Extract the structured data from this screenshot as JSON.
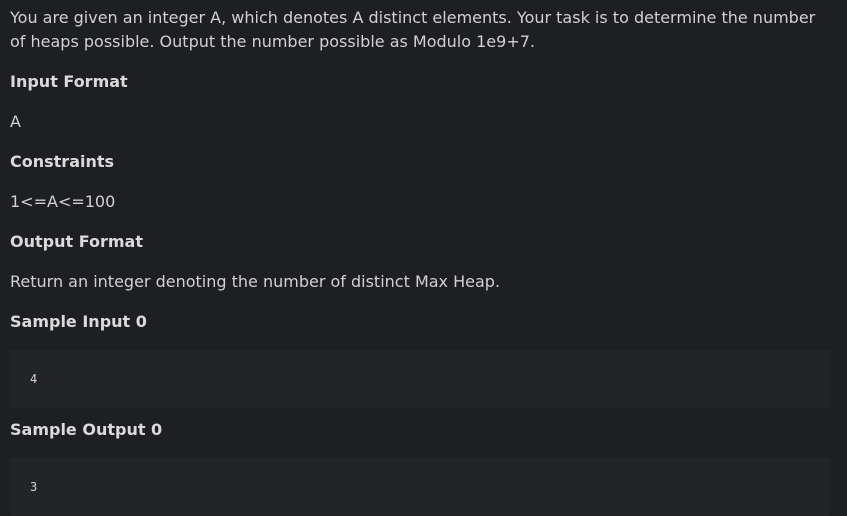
{
  "problem": {
    "description": "You are given an integer A, which denotes A distinct elements. Your task is to determine the number of heaps possible. Output the number possible as Modulo 1e9+7.",
    "input_format": {
      "heading": "Input Format",
      "text": "A"
    },
    "constraints": {
      "heading": "Constraints",
      "text": "1<=A<=100"
    },
    "output_format": {
      "heading": "Output Format",
      "text": "Return an integer denoting the number of distinct Max Heap."
    },
    "sample_input": {
      "heading": "Sample Input 0",
      "code": "4"
    },
    "sample_output": {
      "heading": "Sample Output 0",
      "code": "3"
    }
  }
}
